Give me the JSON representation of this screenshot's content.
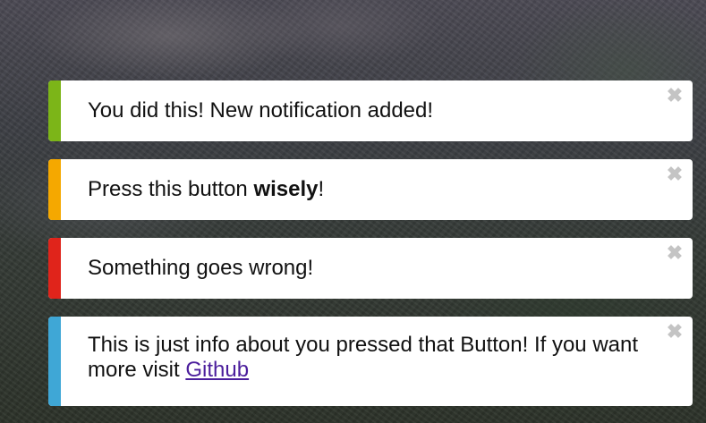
{
  "notifications": [
    {
      "type": "success",
      "accent": "#7cb518",
      "text": "You did this! New notification added!",
      "close_glyph": "✖"
    },
    {
      "type": "warning",
      "accent": "#f5a800",
      "text_before": "Press this button ",
      "text_bold": "wisely",
      "text_after": "!",
      "close_glyph": "✖"
    },
    {
      "type": "error",
      "accent": "#e0241b",
      "text": "Something goes wrong!",
      "close_glyph": "✖"
    },
    {
      "type": "info",
      "accent": "#3fa7d6",
      "text_before": "This is just info about you pressed that Button! If you want more visit ",
      "link_text": "Github",
      "close_glyph": "✖"
    }
  ]
}
